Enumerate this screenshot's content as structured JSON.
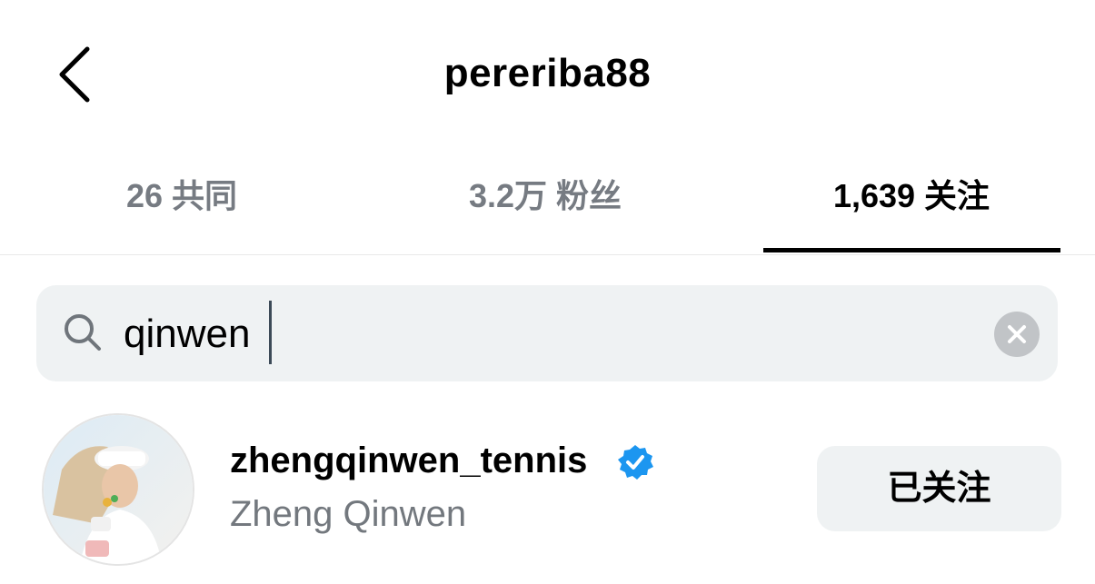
{
  "header": {
    "back_icon": "chevron-left-icon",
    "title": "pereriba88"
  },
  "tabs": [
    {
      "label": "26 共同",
      "active": false
    },
    {
      "label": "3.2万 粉丝",
      "active": false
    },
    {
      "label": "1,639 关注",
      "active": true
    }
  ],
  "search": {
    "icon": "search-icon",
    "value": "qinwen",
    "clear_icon": "clear-icon"
  },
  "results": [
    {
      "username": "zhengqinwen_tennis",
      "full_name": "Zheng Qinwen",
      "verified": true,
      "verified_icon": "verified-badge-icon",
      "follow_button_label": "已关注"
    }
  ],
  "colors": {
    "active_tab": "#000000",
    "inactive_tab": "#767b82",
    "search_bg": "#eff2f3",
    "verified_blue": "#1c96f0",
    "secondary_text": "#73787e"
  }
}
